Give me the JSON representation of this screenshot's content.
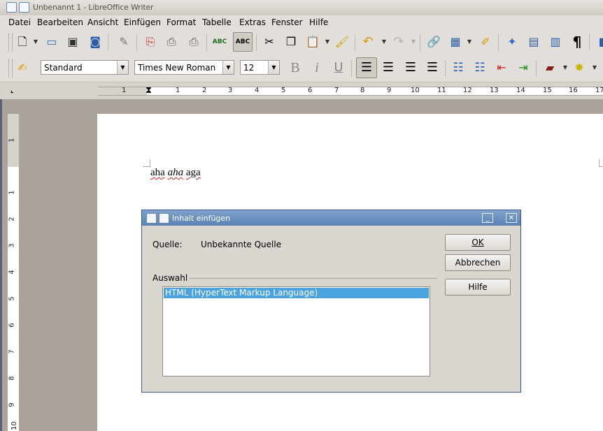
{
  "window": {
    "title": "Unbenannt 1 - LibreOffice Writer"
  },
  "menu": [
    "Datei",
    "Bearbeiten",
    "Ansicht",
    "Einfügen",
    "Format",
    "Tabelle",
    "Extras",
    "Fenster",
    "Hilfe"
  ],
  "format_toolbar": {
    "paragraph_style": "Standard",
    "font_name": "Times New Roman",
    "font_size": "12",
    "bold_glyph": "B",
    "italic_glyph": "i",
    "underline_glyph": "U"
  },
  "toolbar_glyphs": {
    "spellcheck_label": "ABC",
    "autospell_label": "ABC",
    "pilcrow": "¶"
  },
  "ruler": {
    "left_label": "1",
    "marks": [
      "1",
      "2",
      "3",
      "4",
      "5",
      "6",
      "7",
      "8",
      "9",
      "10",
      "11",
      "12",
      "13",
      "14",
      "15",
      "16",
      "17"
    ],
    "vertical_marks": [
      "1",
      "1",
      "2",
      "3",
      "4",
      "5",
      "6",
      "7",
      "8",
      "9",
      "10"
    ]
  },
  "document": {
    "word1": "aha",
    "word2": "aha",
    "word3": "aga"
  },
  "dialog": {
    "title": "Inhalt einfügen",
    "source_label": "Quelle:",
    "source_value": "Unbekannte Quelle",
    "selection_label": "Auswahl",
    "options": [
      "HTML (HyperText Markup Language)"
    ],
    "ok_label": "OK",
    "cancel_label": "Abbrechen",
    "help_label": "Hilfe",
    "minimize_glyph": "_",
    "close_glyph": "✕"
  },
  "colors": {
    "selection": "#4aa3df",
    "dialog_titlebar": "#5a82b3"
  }
}
